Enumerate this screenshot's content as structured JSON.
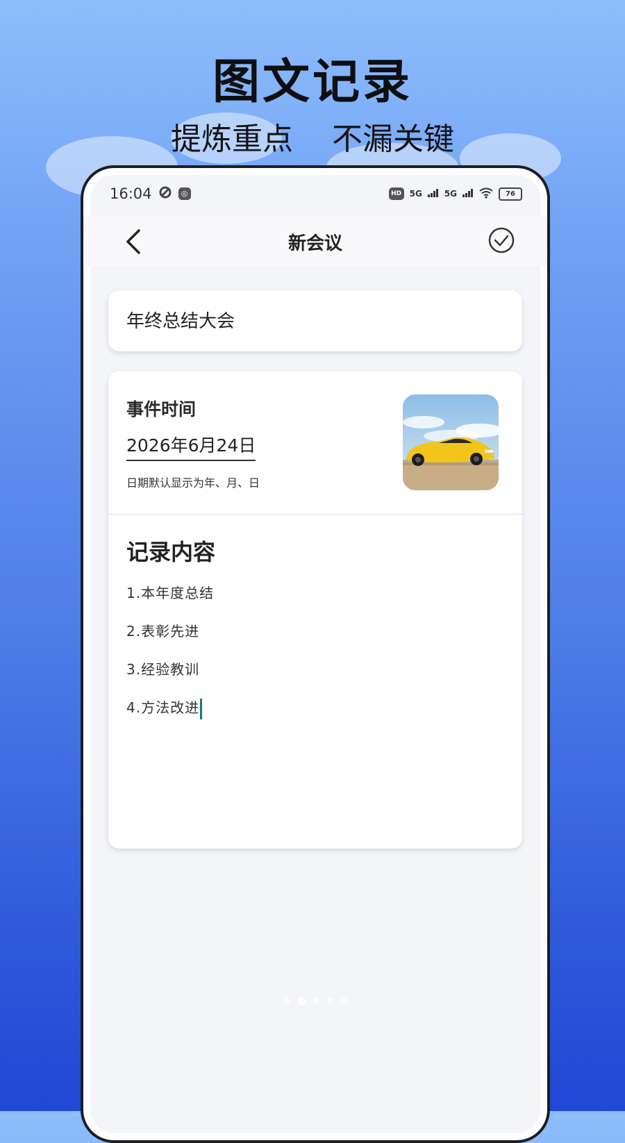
{
  "promo": {
    "headline": "图文记录",
    "subline": "提炼重点    不漏关键"
  },
  "status_bar": {
    "time": "16:04",
    "network": "5G",
    "battery": "76"
  },
  "nav": {
    "title": "新会议"
  },
  "meeting": {
    "title": "年终总结大会",
    "event_label": "事件时间",
    "date": "2026年6月24日",
    "date_hint": "日期默认显示为年、月、日"
  },
  "record": {
    "heading": "记录内容",
    "items": [
      "1.本年度总结",
      "2.表彰先进",
      "3.经验教训",
      "4.方法改进"
    ]
  },
  "pagination": {
    "total": 5,
    "active": 1
  },
  "colors": {
    "background_top": "#8ebdfb",
    "background_bottom": "#2047d6",
    "caret": "#1a7a7a"
  },
  "icons": {
    "back": "chevron-left-icon",
    "confirm": "check-circle-icon",
    "wifi": "wifi-icon",
    "signal": "signal-icon",
    "battery": "battery-icon"
  }
}
